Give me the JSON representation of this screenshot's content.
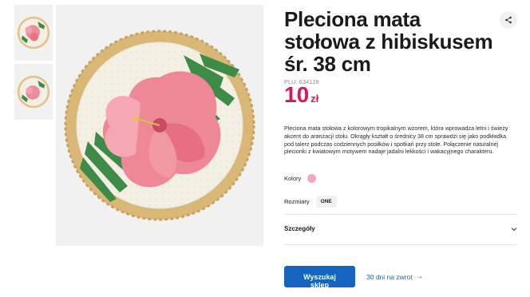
{
  "product": {
    "title": "Pleciona mata stołowa z hibiskusem śr. 38 cm",
    "plu_label": "PLU:",
    "plu_value": "634128",
    "price_value": "10",
    "price_currency": "zł",
    "description": "Pleciona mata stołowa z kolorowym tropikalnym wzorem, która wprowadza letni i świeży akcent do aranżacji stołu. Okrągły kształt o średnicy 38 cm sprawdzi się jako podkładka pod talerz podczas codziennych posiłków i spotkań przy stole. Połączenie naturalnej plecionki z kwiatowym motywem nadaje jadalni lekkości i wakacyjnego charakteru."
  },
  "options": {
    "colors_label": "Kolory",
    "color_swatch": "#f3a7c2",
    "sizes_label": "Rozmiary",
    "size_value": "ONE"
  },
  "details": {
    "label": "Szczegóły"
  },
  "actions": {
    "find_store": "Wyszukaj sklep",
    "returns": "30 dni na zwrot",
    "returns_arrow": "→"
  },
  "icons": {
    "share": "share-icon",
    "chevron": "chevron-down-icon"
  },
  "colors": {
    "accent_price": "#e0135f",
    "primary_button": "#1565c0"
  }
}
